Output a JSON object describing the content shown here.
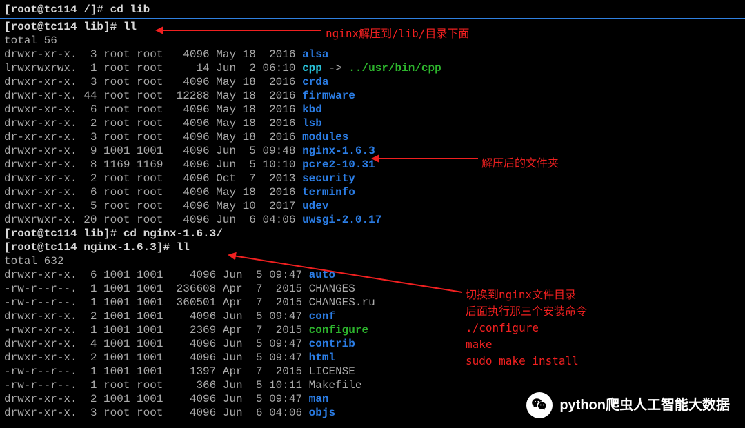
{
  "prompt1": "[root@tc114 /]# cd lib",
  "prompt2": "[root@tc114 lib]# ll",
  "total1": "total 56",
  "ls1": [
    {
      "perm": "drwxr-xr-x.",
      "n": " 3",
      "u": "root",
      "g": "root",
      "size": "  4096",
      "date": "May 18  2016",
      "name": "alsa",
      "color": "blue"
    },
    {
      "perm": "lrwxrwxrwx.",
      "n": " 1",
      "u": "root",
      "g": "root",
      "size": "    14",
      "date": "Jun  2 06:10",
      "name": "cpp",
      "color": "cyan",
      "arrow": " -> ",
      "target": "../usr/bin/cpp",
      "tcolor": "green-bright"
    },
    {
      "perm": "drwxr-xr-x.",
      "n": " 3",
      "u": "root",
      "g": "root",
      "size": "  4096",
      "date": "May 18  2016",
      "name": "crda",
      "color": "blue"
    },
    {
      "perm": "drwxr-xr-x.",
      "n": "44",
      "u": "root",
      "g": "root",
      "size": " 12288",
      "date": "May 18  2016",
      "name": "firmware",
      "color": "blue"
    },
    {
      "perm": "drwxr-xr-x.",
      "n": " 6",
      "u": "root",
      "g": "root",
      "size": "  4096",
      "date": "May 18  2016",
      "name": "kbd",
      "color": "blue"
    },
    {
      "perm": "drwxr-xr-x.",
      "n": " 2",
      "u": "root",
      "g": "root",
      "size": "  4096",
      "date": "May 18  2016",
      "name": "lsb",
      "color": "blue"
    },
    {
      "perm": "dr-xr-xr-x.",
      "n": " 3",
      "u": "root",
      "g": "root",
      "size": "  4096",
      "date": "May 18  2016",
      "name": "modules",
      "color": "blue"
    },
    {
      "perm": "drwxr-xr-x.",
      "n": " 9",
      "u": "1001",
      "g": "1001",
      "size": "  4096",
      "date": "Jun  5 09:48",
      "name": "nginx-1.6.3",
      "color": "blue"
    },
    {
      "perm": "drwxr-xr-x.",
      "n": " 8",
      "u": "1169",
      "g": "1169",
      "size": "  4096",
      "date": "Jun  5 10:10",
      "name": "pcre2-10.31",
      "color": "blue"
    },
    {
      "perm": "drwxr-xr-x.",
      "n": " 2",
      "u": "root",
      "g": "root",
      "size": "  4096",
      "date": "Oct  7  2013",
      "name": "security",
      "color": "blue"
    },
    {
      "perm": "drwxr-xr-x.",
      "n": " 6",
      "u": "root",
      "g": "root",
      "size": "  4096",
      "date": "May 18  2016",
      "name": "terminfo",
      "color": "blue"
    },
    {
      "perm": "drwxr-xr-x.",
      "n": " 5",
      "u": "root",
      "g": "root",
      "size": "  4096",
      "date": "May 10  2017",
      "name": "udev",
      "color": "blue"
    },
    {
      "perm": "drwxrwxr-x.",
      "n": "20",
      "u": "root",
      "g": "root",
      "size": "  4096",
      "date": "Jun  6 04:06",
      "name": "uwsgi-2.0.17",
      "color": "blue"
    }
  ],
  "prompt3": "[root@tc114 lib]# cd nginx-1.6.3/",
  "prompt4": "[root@tc114 nginx-1.6.3]# ll",
  "total2": "total 632",
  "ls2": [
    {
      "perm": "drwxr-xr-x.",
      "n": "6",
      "u": "1001",
      "g": "1001",
      "size": "   4096",
      "date": "Jun  5 09:47",
      "name": "auto",
      "color": "blue"
    },
    {
      "perm": "-rw-r--r--.",
      "n": "1",
      "u": "1001",
      "g": "1001",
      "size": " 236608",
      "date": "Apr  7  2015",
      "name": "CHANGES",
      "color": "dim"
    },
    {
      "perm": "-rw-r--r--.",
      "n": "1",
      "u": "1001",
      "g": "1001",
      "size": " 360501",
      "date": "Apr  7  2015",
      "name": "CHANGES.ru",
      "color": "dim"
    },
    {
      "perm": "drwxr-xr-x.",
      "n": "2",
      "u": "1001",
      "g": "1001",
      "size": "   4096",
      "date": "Jun  5 09:47",
      "name": "conf",
      "color": "blue"
    },
    {
      "perm": "-rwxr-xr-x.",
      "n": "1",
      "u": "1001",
      "g": "1001",
      "size": "   2369",
      "date": "Apr  7  2015",
      "name": "configure",
      "color": "green-bright"
    },
    {
      "perm": "drwxr-xr-x.",
      "n": "4",
      "u": "1001",
      "g": "1001",
      "size": "   4096",
      "date": "Jun  5 09:47",
      "name": "contrib",
      "color": "blue"
    },
    {
      "perm": "drwxr-xr-x.",
      "n": "2",
      "u": "1001",
      "g": "1001",
      "size": "   4096",
      "date": "Jun  5 09:47",
      "name": "html",
      "color": "blue"
    },
    {
      "perm": "-rw-r--r--.",
      "n": "1",
      "u": "1001",
      "g": "1001",
      "size": "   1397",
      "date": "Apr  7  2015",
      "name": "LICENSE",
      "color": "dim"
    },
    {
      "perm": "-rw-r--r--.",
      "n": "1",
      "u": "root",
      "g": "root",
      "size": "    366",
      "date": "Jun  5 10:11",
      "name": "Makefile",
      "color": "dim"
    },
    {
      "perm": "drwxr-xr-x.",
      "n": "2",
      "u": "1001",
      "g": "1001",
      "size": "   4096",
      "date": "Jun  5 09:47",
      "name": "man",
      "color": "blue"
    },
    {
      "perm": "drwxr-xr-x.",
      "n": "3",
      "u": "root",
      "g": "root",
      "size": "   4096",
      "date": "Jun  6 04:06",
      "name": "objs",
      "color": "blue"
    }
  ],
  "anno1": "nginx解压到/lib/目录下面",
  "anno2": "解压后的文件夹",
  "anno3_l1": "切换到nginx文件目录",
  "anno3_l2": "后面执行那三个安装命令",
  "anno3_l3": "./configure",
  "anno3_l4": "make",
  "anno3_l5": "sudo make install",
  "watermark_text": "python爬虫人工智能大数据"
}
